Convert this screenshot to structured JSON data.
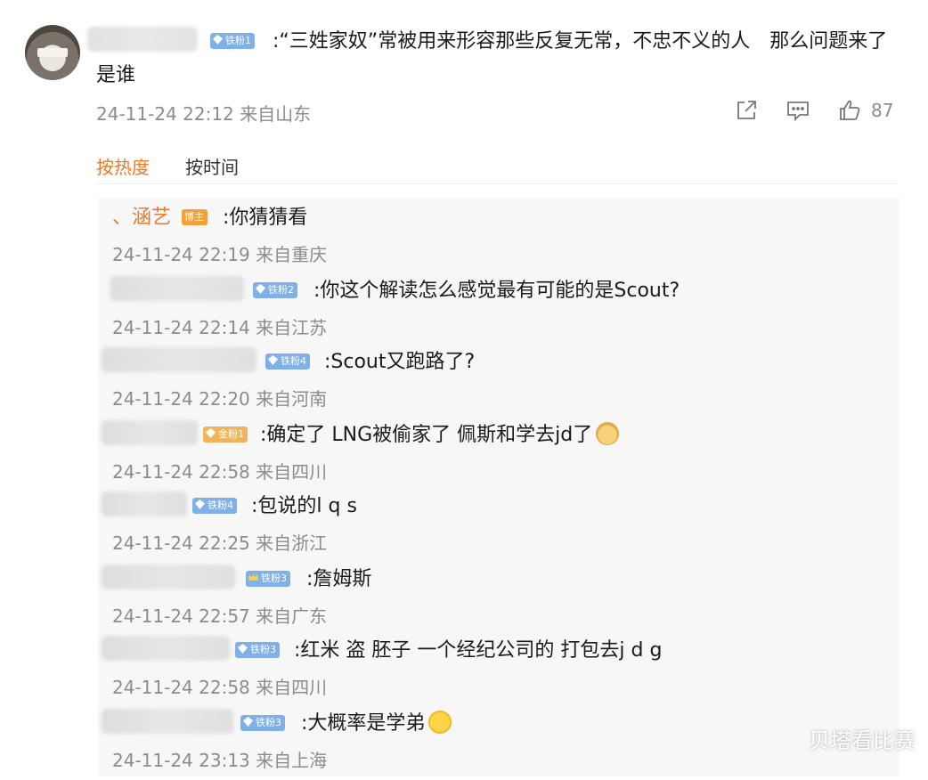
{
  "post": {
    "badge_level": "铁粉1",
    "text": ":“三姓家奴”常被用来形容那些反复无常，不忠不义的人　那么问题来了　是谁",
    "meta": "24-11-24 22:12 来自山东",
    "like_count": "87",
    "icons": [
      "share-icon",
      "comment-icon",
      "like-icon"
    ]
  },
  "sort": {
    "hot_label": "按热度",
    "time_label": "按时间"
  },
  "replies": [
    {
      "name": "、涵艺",
      "badge": "博主",
      "badge_kind": "author",
      "text": ":你猜猜看",
      "meta": "24-11-24 22:19 来自重庆"
    },
    {
      "badge": "铁粉2",
      "badge_kind": "fan",
      "text": ":你这个解读怎么感觉最有可能的是Scout?",
      "meta": "24-11-24 22:14 来自江苏"
    },
    {
      "badge": "铁粉4",
      "badge_kind": "fan",
      "text": ":Scout又跑路了?",
      "meta": "24-11-24 22:20 来自河南"
    },
    {
      "badge": "金粉1",
      "badge_kind": "gold",
      "text": ":确定了 LNG被偷家了 佩斯和学去jd了",
      "meta": "24-11-24 22:58 来自四川"
    },
    {
      "badge": "铁粉4",
      "badge_kind": "fan",
      "text": ":包说的l q s",
      "meta": "24-11-24 22:25 来自浙江"
    },
    {
      "badge": "铁粉3",
      "badge_kind": "fan",
      "text": ":詹姆斯",
      "meta": "24-11-24 22:57 来自广东"
    },
    {
      "badge": "铁粉3",
      "badge_kind": "fan",
      "text": ":红米 盗 胚子 一个经纪公司的 打包去j d g",
      "meta": "24-11-24 22:58 来自四川"
    },
    {
      "badge": "铁粉3",
      "badge_kind": "fan",
      "text": ":大概率是学弟",
      "meta": "24-11-24 23:13 来自上海"
    }
  ],
  "watermark": "贝塔看比赛",
  "colors": {
    "accent": "#ec7a2a",
    "fan_badge": "#7fb0e8",
    "gold_badge": "#f0b45a",
    "meta": "#8c8c8c"
  }
}
